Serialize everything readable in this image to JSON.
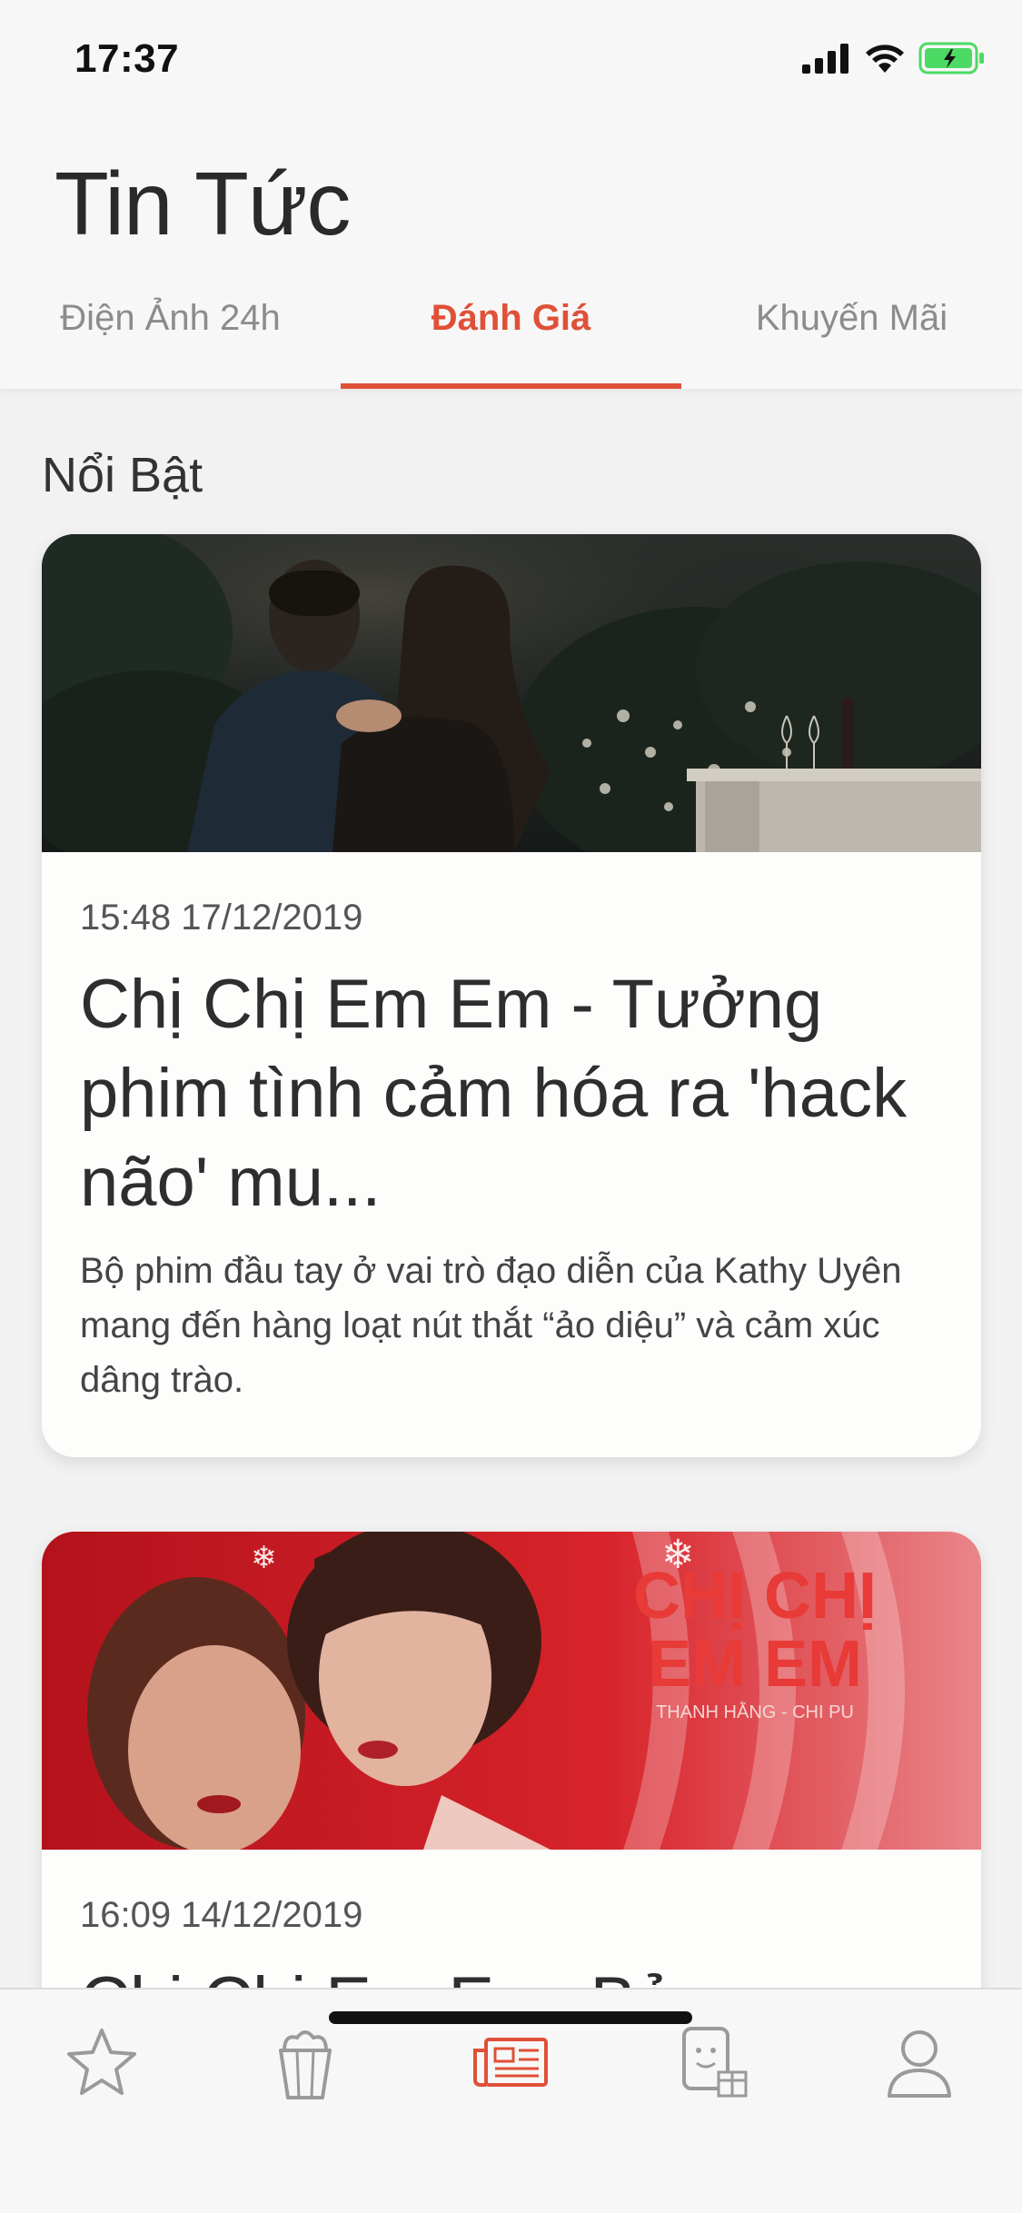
{
  "status_bar": {
    "time": "17:37"
  },
  "header": {
    "title": "Tin Tức"
  },
  "tabs": [
    {
      "label": "Điện Ảnh 24h",
      "active": false
    },
    {
      "label": "Đánh Giá",
      "active": true
    },
    {
      "label": "Khuyến Mãi",
      "active": false
    }
  ],
  "section": {
    "title": "Nổi Bật"
  },
  "articles": [
    {
      "date": "15:48 17/12/2019",
      "title": "Chị Chị Em Em - Tưởng phim tình cảm hóa ra 'hack não' mu...",
      "description": "Bộ phim đầu tay ở vai trò đạo diễn của Kathy Uyên mang đến hàng loạt nút thắt “ảo diệu” và cảm xúc dâng trào."
    },
    {
      "date": "16:09 14/12/2019",
      "title": "Chị Chị Em Em: Bản...",
      "poster_title_line1": "CHỊ CHỊ",
      "poster_title_line2": "EM EM",
      "poster_cast": "THANH HẰNG - CHI PU"
    }
  ],
  "tabbar": [
    {
      "icon": "star-icon",
      "active": false
    },
    {
      "icon": "popcorn-icon",
      "active": false
    },
    {
      "icon": "newspaper-icon",
      "active": true
    },
    {
      "icon": "ticket-gift-icon",
      "active": false
    },
    {
      "icon": "profile-icon",
      "active": false
    }
  ],
  "colors": {
    "accent": "#e05038",
    "inactive_tab": "#8c8c8c",
    "background": "#f2f2f2",
    "battery": "#4cd964"
  }
}
